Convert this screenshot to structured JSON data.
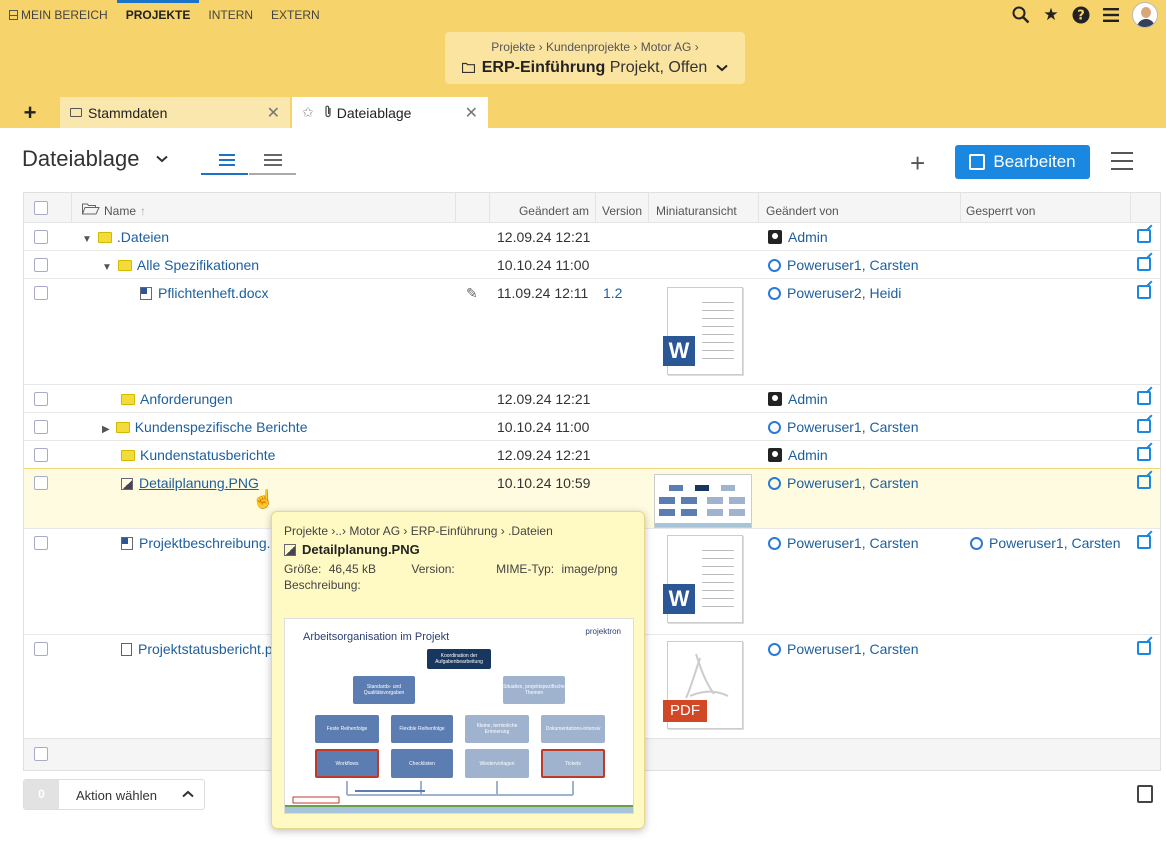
{
  "topnav": [
    {
      "label": "MEIN BEREICH",
      "active": false
    },
    {
      "label": "PROJEKTE",
      "active": true
    },
    {
      "label": "INTERN",
      "active": false
    },
    {
      "label": "EXTERN",
      "active": false
    }
  ],
  "breadcrumb": {
    "path": "Projekte  ›  Kundenprojekte  ›  Motor AG  ›",
    "title": "ERP-Einführung",
    "subtitle": "Projekt, Offen"
  },
  "tabs": {
    "stammdaten": "Stammdaten",
    "dateiablage": "Dateiablage"
  },
  "page": {
    "title": "Dateiablage",
    "edit_label": "Bearbeiten"
  },
  "columns": {
    "name": "Name",
    "changed_at": "Geändert am",
    "version": "Version",
    "thumbnail": "Miniaturansicht",
    "changed_by": "Geändert von",
    "locked_by": "Gesperrt von"
  },
  "rows": [
    {
      "name": ".Dateien",
      "date": "12.09.24 12:21",
      "version": "",
      "user": "Admin",
      "locked": ""
    },
    {
      "name": "Alle Spezifikationen",
      "date": "10.10.24 11:00",
      "version": "",
      "user": "Poweruser1, Carsten",
      "locked": ""
    },
    {
      "name": "Pflichtenheft.docx",
      "date": "11.09.24 12:11",
      "version": "1.2",
      "user": "Poweruser2, Heidi",
      "locked": ""
    },
    {
      "name": "Anforderungen",
      "date": "12.09.24 12:21",
      "version": "",
      "user": "Admin",
      "locked": ""
    },
    {
      "name": "Kundenspezifische Berichte",
      "date": "10.10.24 11:00",
      "version": "",
      "user": "Poweruser1, Carsten",
      "locked": ""
    },
    {
      "name": "Kundenstatusberichte",
      "date": "12.09.24 12:21",
      "version": "",
      "user": "Admin",
      "locked": ""
    },
    {
      "name": "Detailplanung.PNG",
      "date": "10.10.24 10:59",
      "version": "",
      "user": "Poweruser1, Carsten",
      "locked": ""
    },
    {
      "name": "Projektbeschreibung.",
      "date": "",
      "version": "",
      "user": "Poweruser1, Carsten",
      "locked": "Poweruser1, Carsten"
    },
    {
      "name": "Projektstatusbericht.p",
      "date": "",
      "version": "",
      "user": "Poweruser1, Carsten",
      "locked": ""
    }
  ],
  "thumb_labels": {
    "word": "W",
    "pdf": "PDF"
  },
  "footer": {
    "count": "0",
    "action_label": "Aktion wählen"
  },
  "popup": {
    "path": "Projekte ›..› Motor AG › ERP-Einführung › .Dateien",
    "title": "Detailplanung.PNG",
    "size_label": "Größe:",
    "size_value": "46,45 kB",
    "version_label": "Version:",
    "mime_label": "MIME-Typ:",
    "mime_value": "image/png",
    "desc_label": "Beschreibung:",
    "preview": {
      "title": "Arbeitsorganisation im Projekt",
      "logo": "projektron",
      "boxes": {
        "koord": "Koordination der Aufgabenbearbeitung",
        "standards": "Standards- und Qualitätsvorgaben",
        "situativ": "Situative, projektspezifische Themen",
        "feste": "Feste Reihenfolge",
        "flexible": "Flexible Reihenfolge",
        "kleine": "Kleine, terminliche Erinnerung",
        "doku": "Dokumentations-intensiv",
        "workflows": "Workflows",
        "checklisten": "Checklisten",
        "wiedervorlagen": "Wiedervorlagen",
        "tickets": "Tickets"
      }
    }
  },
  "colors": {
    "header_bg": "#f7d36b",
    "accent": "#1a88e0",
    "link": "#1d5f9e",
    "highlight_row": "#fffbe0",
    "popup_bg": "#fff9c4"
  }
}
